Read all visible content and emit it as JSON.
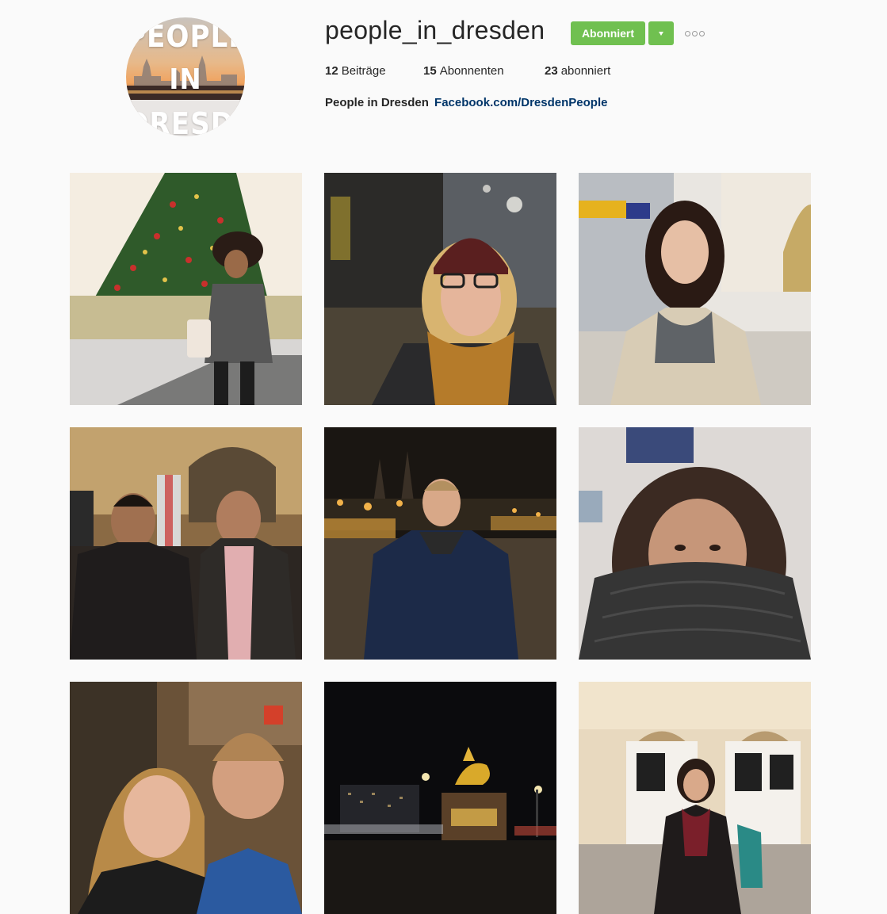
{
  "profile": {
    "username": "people_in_dresden",
    "avatar_text": [
      "PEOPLE",
      "IN",
      "DRESDEN"
    ],
    "follow_button": "Abonniert",
    "dropdown_icon": "caret-down-icon",
    "more_icon": "more-options-icon",
    "accent_color": "#70c050",
    "stats": {
      "posts": {
        "count": "12",
        "label": "Beiträge"
      },
      "followers": {
        "count": "15",
        "label": "Abonnenten"
      },
      "following": {
        "count": "23",
        "label": "abonniert"
      }
    },
    "bio": {
      "name": "People in Dresden",
      "link": "Facebook.com/DresdenPeople",
      "link_color": "#003569"
    }
  },
  "posts": [
    {
      "scene": "woman in front of christmas tree"
    },
    {
      "scene": "woman with knit hat and scarf"
    },
    {
      "scene": "woman in train station"
    },
    {
      "scene": "two men in station"
    },
    {
      "scene": "man in blue jacket at night"
    },
    {
      "scene": "woman with scarf over face"
    },
    {
      "scene": "smiling couple"
    },
    {
      "scene": "golden rider statue at night"
    },
    {
      "scene": "woman in station hall"
    }
  ]
}
